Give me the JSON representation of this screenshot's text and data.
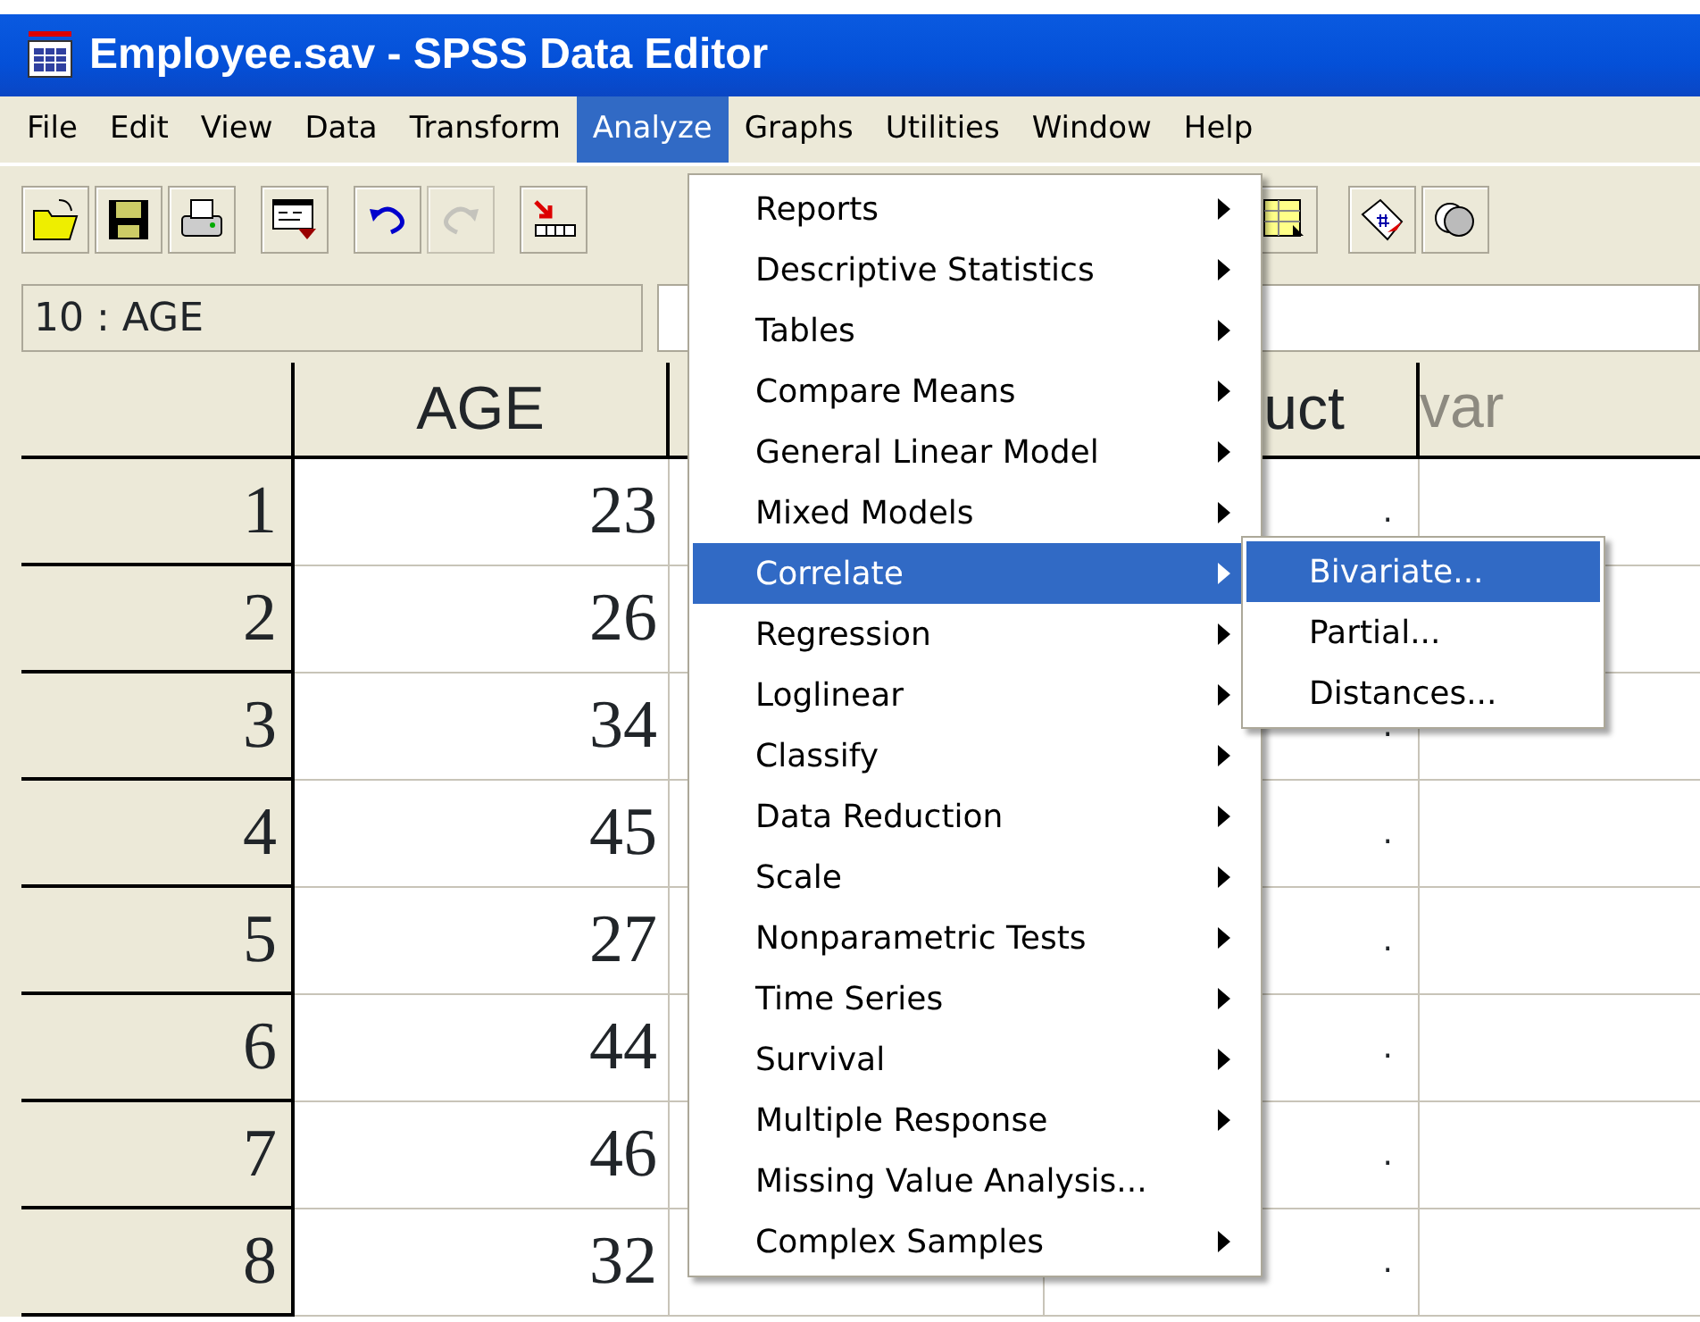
{
  "window": {
    "title": "Employee.sav - SPSS Data Editor"
  },
  "menu_bar": [
    {
      "label": "File",
      "selected": false
    },
    {
      "label": "Edit",
      "selected": false
    },
    {
      "label": "View",
      "selected": false
    },
    {
      "label": "Data",
      "selected": false
    },
    {
      "label": "Transform",
      "selected": false
    },
    {
      "label": "Analyze",
      "selected": true
    },
    {
      "label": "Graphs",
      "selected": false
    },
    {
      "label": "Utilities",
      "selected": false
    },
    {
      "label": "Window",
      "selected": false
    },
    {
      "label": "Help",
      "selected": false
    }
  ],
  "toolbar": [
    {
      "kind": "open",
      "disabled": false
    },
    {
      "kind": "save",
      "disabled": false
    },
    {
      "kind": "print",
      "disabled": false
    },
    {
      "kind": "dialog",
      "disabled": false
    },
    {
      "kind": "undo",
      "disabled": false
    },
    {
      "kind": "redo",
      "disabled": true
    },
    {
      "kind": "goto",
      "disabled": false
    },
    {
      "kind": "grid",
      "disabled": false
    },
    {
      "kind": "tag",
      "disabled": false
    },
    {
      "kind": "circles",
      "disabled": false
    }
  ],
  "cell_editor": {
    "cell": "10 : AGE"
  },
  "grid": {
    "columns": [
      {
        "label": "AGE",
        "disabled": false
      },
      {
        "label": "uct",
        "disabled": false
      },
      {
        "label": "var",
        "disabled": true
      }
    ],
    "rows": [
      {
        "row": "1",
        "age": "23",
        "column_4": "."
      },
      {
        "row": "2",
        "age": "26"
      },
      {
        "row": "3",
        "age": "34",
        "column_4": "."
      },
      {
        "row": "4",
        "age": "45",
        "column_4": "."
      },
      {
        "row": "5",
        "age": "27",
        "column_4": "."
      },
      {
        "row": "6",
        "age": "44",
        "column_4": "."
      },
      {
        "row": "7",
        "age": "46",
        "column_4": "."
      },
      {
        "row": "8",
        "age": "32",
        "column_4": "."
      }
    ]
  },
  "analyze_menu": {
    "items": [
      {
        "label": "Reports",
        "submenu": true,
        "selected": false
      },
      {
        "label": "Descriptive Statistics",
        "submenu": true,
        "selected": false
      },
      {
        "label": "Tables",
        "submenu": true,
        "selected": false
      },
      {
        "label": "Compare Means",
        "submenu": true,
        "selected": false
      },
      {
        "label": "General Linear Model",
        "submenu": true,
        "selected": false
      },
      {
        "label": "Mixed Models",
        "submenu": true,
        "selected": false
      },
      {
        "label": "Correlate",
        "submenu": true,
        "selected": true
      },
      {
        "label": "Regression",
        "submenu": true,
        "selected": false
      },
      {
        "label": "Loglinear",
        "submenu": true,
        "selected": false
      },
      {
        "label": "Classify",
        "submenu": true,
        "selected": false
      },
      {
        "label": "Data Reduction",
        "submenu": true,
        "selected": false
      },
      {
        "label": "Scale",
        "submenu": true,
        "selected": false
      },
      {
        "label": "Nonparametric Tests",
        "submenu": true,
        "selected": false
      },
      {
        "label": "Time Series",
        "submenu": true,
        "selected": false
      },
      {
        "label": "Survival",
        "submenu": true,
        "selected": false
      },
      {
        "label": "Multiple Response",
        "submenu": true,
        "selected": false
      },
      {
        "label": "Missing Value Analysis...",
        "submenu": false,
        "selected": false
      },
      {
        "label": "Complex Samples",
        "submenu": true,
        "selected": false
      }
    ]
  },
  "correlate_submenu": {
    "items": [
      {
        "label": "Bivariate...",
        "selected": true
      },
      {
        "label": "Partial...",
        "selected": false
      },
      {
        "label": "Distances...",
        "selected": false
      }
    ]
  }
}
